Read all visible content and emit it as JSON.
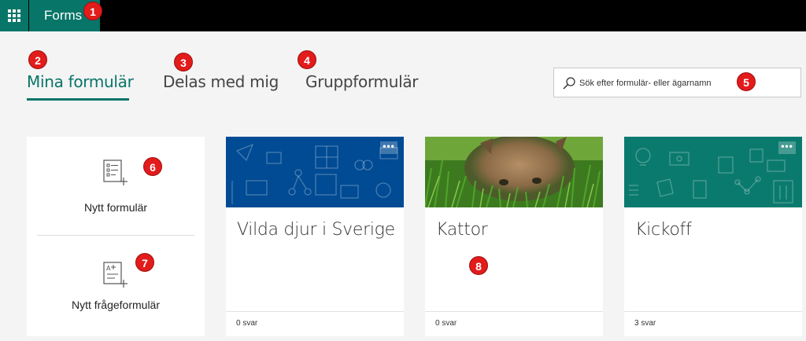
{
  "app": {
    "name": "Forms"
  },
  "tabs": [
    {
      "label": "Mina formulär",
      "active": true
    },
    {
      "label": "Delas med mig",
      "active": false
    },
    {
      "label": "Gruppformulär",
      "active": false
    }
  ],
  "search": {
    "placeholder": "Sök efter formulär- eller ägarnamn"
  },
  "new_panel": {
    "new_form_label": "Nytt formulär",
    "new_quiz_label": "Nytt frågeformulär"
  },
  "cards": [
    {
      "title": "Vilda djur i Sverige",
      "responses": "0 svar",
      "banner_color": "#004b93",
      "more": "•••"
    },
    {
      "title": "Kattor",
      "responses": "0 svar",
      "more": ""
    },
    {
      "title": "Kickoff",
      "responses": "3 svar",
      "banner_color": "#0b7a6e",
      "more": "•••"
    }
  ],
  "callouts": [
    "1",
    "2",
    "3",
    "4",
    "5",
    "6",
    "7",
    "8"
  ],
  "colors": {
    "accent": "#077568",
    "topbar": "#000000",
    "callout": "#e21b1b"
  }
}
